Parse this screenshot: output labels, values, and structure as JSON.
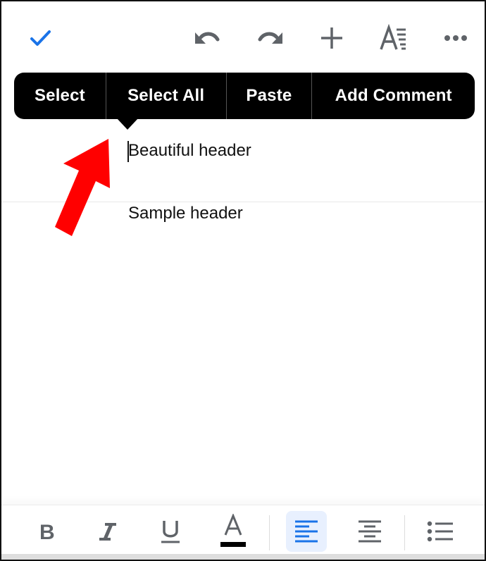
{
  "toolbar": {
    "done_icon": "checkmark-icon",
    "undo_icon": "undo-icon",
    "redo_icon": "redo-icon",
    "insert_icon": "plus-icon",
    "format_icon": "text-format-icon",
    "more_icon": "more-horizontal-icon",
    "accent_color": "#1a73e8",
    "icon_color": "#5f6368"
  },
  "context_menu": {
    "items": [
      {
        "label": "Select"
      },
      {
        "label": "Select All"
      },
      {
        "label": "Paste"
      },
      {
        "label": "Add Comment"
      }
    ]
  },
  "document": {
    "lines": [
      {
        "text": "Beautiful header"
      },
      {
        "text": "Sample header"
      }
    ]
  },
  "annotation": {
    "arrow_color": "#ff0000"
  },
  "format_bar": {
    "bold_icon": "bold-icon",
    "italic_icon": "italic-icon",
    "underline_icon": "underline-icon",
    "text_color_icon": "text-color-icon",
    "text_color_value": "#000000",
    "align_left_icon": "align-left-icon",
    "align_left_active": true,
    "align_center_icon": "align-center-icon",
    "bulleted_list_icon": "bulleted-list-icon"
  }
}
